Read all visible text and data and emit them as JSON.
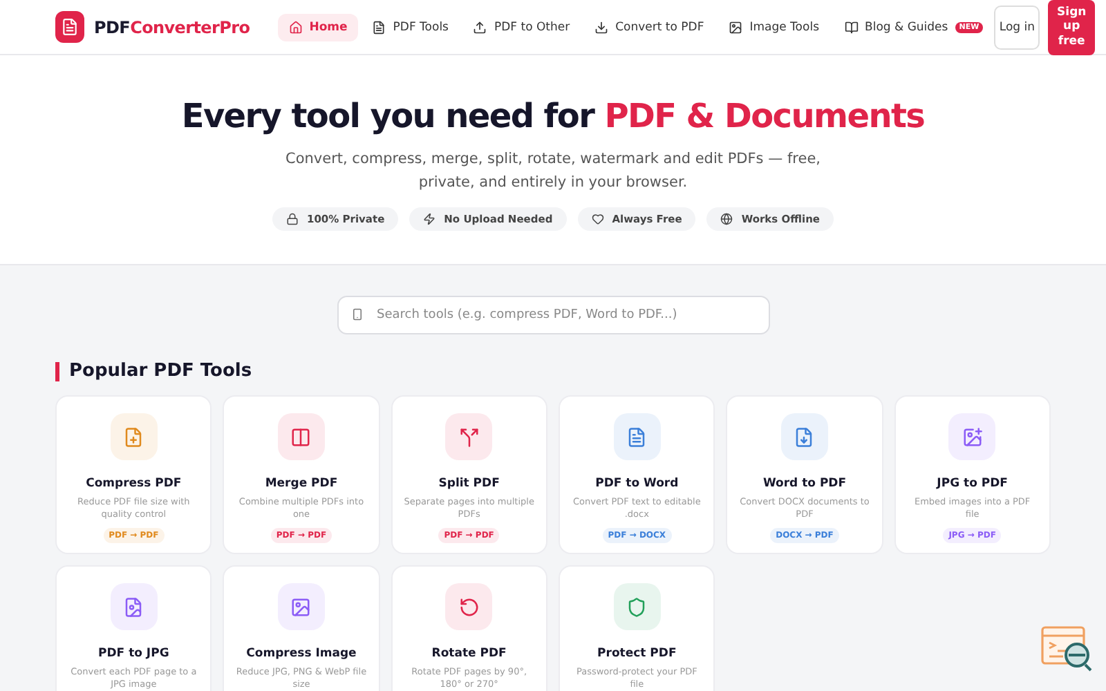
{
  "brand": {
    "prefix": "PDF",
    "name": "ConverterPro"
  },
  "nav": [
    {
      "label": "Home",
      "selected": true
    },
    {
      "label": "PDF Tools",
      "selected": false
    },
    {
      "label": "PDF to Other",
      "selected": false
    },
    {
      "label": "Convert to PDF",
      "selected": false
    },
    {
      "label": "Image Tools",
      "selected": false
    },
    {
      "label": "Blog & Guides",
      "selected": false,
      "badge": "NEW"
    }
  ],
  "auth": {
    "login": "Log in",
    "signup": "Sign up free"
  },
  "hero": {
    "title": "Every tool you need for",
    "highlight": "PDF & Documents",
    "subtitle": "Convert, compress, merge, split, rotate, watermark and edit PDFs — free, private, and entirely in your browser.",
    "features": [
      "100% Private",
      "No Upload Needed",
      "Always Free",
      "Works Offline"
    ]
  },
  "search": {
    "placeholder": "Search tools (e.g. compress PDF, Word to PDF...)"
  },
  "section": {
    "title": "Popular PDF Tools"
  },
  "tools": [
    {
      "name": "Compress PDF",
      "description": "Reduce PDF file size with quality control",
      "tag": "PDF → PDF",
      "color": "#e08a1e"
    },
    {
      "name": "Merge PDF",
      "description": "Combine multiple PDFs into one",
      "tag": "PDF → PDF",
      "color": "#e0244a"
    },
    {
      "name": "Split PDF",
      "description": "Separate pages into multiple PDFs",
      "tag": "PDF → PDF",
      "color": "#e0244a"
    },
    {
      "name": "PDF to Word",
      "description": "Convert PDF text to editable .docx",
      "tag": "PDF → DOCX",
      "color": "#3b7fd9"
    },
    {
      "name": "Word to PDF",
      "description": "Convert DOCX documents to PDF",
      "tag": "DOCX → PDF",
      "color": "#3b7fd9"
    },
    {
      "name": "JPG to PDF",
      "description": "Embed images into a PDF file",
      "tag": "JPG → PDF",
      "color": "#8b5cf6"
    },
    {
      "name": "PDF to JPG",
      "description": "Convert each PDF page to a JPG image",
      "color": "#8b5cf6"
    },
    {
      "name": "Compress Image",
      "description": "Reduce JPG, PNG & WebP file size",
      "color": "#8b5cf6"
    },
    {
      "name": "Rotate PDF",
      "description": "Rotate PDF pages by 90°, 180° or 270°",
      "color": "#e0244a"
    },
    {
      "name": "Protect PDF",
      "description": "Password-protect your PDF file",
      "color": "#22a05a"
    }
  ]
}
